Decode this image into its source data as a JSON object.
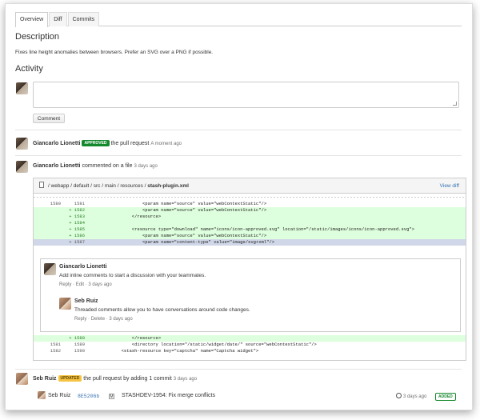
{
  "tabs": [
    "Overview",
    "Diff",
    "Commits"
  ],
  "description": {
    "heading": "Description",
    "text": "Fixes line height anomalies between browsers. Prefer an SVG over a PNG if possible."
  },
  "activity": {
    "heading": "Activity",
    "comment_button": "Comment"
  },
  "events": [
    {
      "name": "Giancarlo Lionetti",
      "badge": "APPROVED",
      "action": "the pull request",
      "time": "A moment ago"
    },
    {
      "name": "Giancarlo Lionetti",
      "action": "commented on a file",
      "time": "3 days ago"
    }
  ],
  "diff": {
    "path_prefix": "/ webapp / default / src / main / resources / ",
    "filename": "stash-plugin.xml",
    "view_diff": "View diff",
    "lines_top": [
      {
        "n1": "1580",
        "n2": "1581",
        "type": "ctx",
        "code": "                    <param name=\"source\" value=\"webContextStatic\"/>"
      },
      {
        "n1": "",
        "n2": "+ 1582",
        "type": "add",
        "code": "                    <param name=\"source\" value=\"webContextStatic\"/>"
      },
      {
        "n1": "",
        "n2": "+ 1583",
        "type": "add",
        "code": "                </resource>"
      },
      {
        "n1": "",
        "n2": "+ 1584",
        "type": "add",
        "code": ""
      },
      {
        "n1": "",
        "n2": "+ 1585",
        "type": "add",
        "code": "                <resource type=\"download\" name=\"icons/icon-approved.svg\" location=\"/static/images/icons/icon-approved.svg\">"
      },
      {
        "n1": "",
        "n2": "+ 1586",
        "type": "add",
        "code": "                    <param name=\"source\" value=\"webContextStatic\"/>"
      },
      {
        "n1": "",
        "n2": "+ 1587",
        "type": "sel",
        "code": "                    <param name=\"content-type\" value=\"image/svg+xml\"/>"
      }
    ],
    "lines_bottom": [
      {
        "n1": "",
        "n2": "+ 1588",
        "type": "add",
        "code": "                </resource>"
      },
      {
        "n1": "1581",
        "n2": "1589",
        "type": "ctx",
        "code": "                <directory location=\"/static/widget/date/\" source=\"webContextStatic\"/>"
      },
      {
        "n1": "1582",
        "n2": "1590",
        "type": "ctx",
        "code": "            <stash-resource key=\"captcha\" name=\"Captcha widget\">"
      }
    ]
  },
  "inline_comment": {
    "name": "Giancarlo Lionetti",
    "text": "Add inline comments to start a discussion with your teammates.",
    "reply": "Reply",
    "edit": "Edit",
    "time": "3 days ago",
    "reply_comment": {
      "name": "Seb Ruiz",
      "text": "Threaded comments allow you to have conversations around code changes.",
      "reply": "Reply",
      "delete": "Delete",
      "time": "3 days ago"
    }
  },
  "update_event": {
    "name": "Seb Ruiz",
    "badge": "UPDATED",
    "action": "the pull request by adding 1 commit",
    "time": "3 days ago"
  },
  "commit": {
    "author": "Seb Ruiz",
    "hash": "8E5206b",
    "merge_marker": "M",
    "message": "STASHDEV-1954: Fix merge conflicts",
    "time": "3 days ago",
    "badge": "ADDED"
  },
  "colors": {
    "link": "#3572b0",
    "approved": "#14892c",
    "updated": "#f6c342",
    "added_line": "#ddffdd"
  }
}
